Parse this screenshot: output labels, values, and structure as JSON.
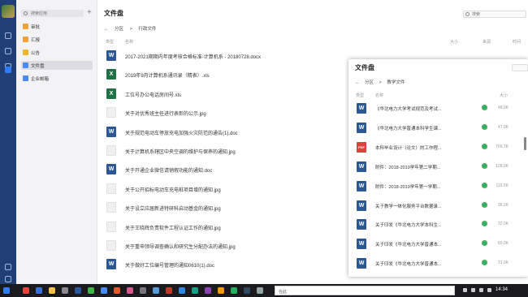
{
  "sidebar": {
    "search_placeholder": "搜索应用",
    "add_label": "+",
    "items": [
      {
        "label": "审批",
        "icon": "approval-icon",
        "color": "#f2a23a"
      },
      {
        "label": "汇报",
        "icon": "report-icon",
        "color": "#f2a23a"
      },
      {
        "label": "公告",
        "icon": "announcement-icon",
        "color": "#f0b429"
      },
      {
        "label": "文件盘",
        "icon": "drive-icon",
        "color": "#4a8bf5",
        "active": true
      },
      {
        "label": "企业邮箱",
        "icon": "mail-icon",
        "color": "#4a8bf5"
      }
    ]
  },
  "main": {
    "title": "文件盘",
    "search_placeholder": "搜索",
    "breadcrumb": [
      "←",
      "分区",
      ">",
      "行政文件"
    ],
    "columns": {
      "type": "类型",
      "name": "名称",
      "size": "大小",
      "source": "来源",
      "time": "时间"
    },
    "files": [
      {
        "type": "word",
        "name": "2017-2021期期内年度考核合格标准-计算机系 - 20180728.docx"
      },
      {
        "type": "excel",
        "name": "2019年9月计算机系通讯录（精表）.xls"
      },
      {
        "type": "excel",
        "name": "工位号办公电话房间号.xls"
      },
      {
        "type": "image",
        "name": "关于对优秀班主任进行表彰的公示.jpg"
      },
      {
        "type": "word",
        "name": "关于规范电动车停放充电加强火灾防范的通告(1).doc"
      },
      {
        "type": "image",
        "name": "关于计算机系辖区中央空调的维护与保养的通知.jpg"
      },
      {
        "type": "word",
        "name": "关于开通企业微信请销假功能的通知.doc"
      },
      {
        "type": "image",
        "name": "关于公开招标电动车充电桩项目增的通知.jpg"
      },
      {
        "type": "image",
        "name": "关于设立应届新进特研科启动基金的通知.jpg"
      },
      {
        "type": "image",
        "name": "关于王晓辉负责软件工程认证工作的通知.jpg"
      },
      {
        "type": "image",
        "name": "关于重申领导调查确认和研究生分配办法的通知.jpg"
      },
      {
        "type": "word",
        "name": "关于做好工位编号管理的通知0610(1).doc"
      }
    ]
  },
  "window2": {
    "title": "文件盘",
    "breadcrumb": [
      "←",
      "分区",
      ">",
      "教学文件"
    ],
    "columns": {
      "type": "类型",
      "name": "名称",
      "size": "大小"
    },
    "files": [
      {
        "type": "word",
        "name": "《华北电力大学考试规范及考试...",
        "size": "48.0K"
      },
      {
        "type": "word",
        "name": "《华北电力大学普通本科学生课...",
        "size": "47.0K"
      },
      {
        "type": "pdf",
        "name": "本科毕业设计（论文）的工作程...",
        "size": "766.7K"
      },
      {
        "type": "word",
        "name": "附件：2018-2019学年第二学期...",
        "size": "128.0K"
      },
      {
        "type": "word",
        "name": "附件：2018-2019学年第一学期...",
        "size": "119.5K"
      },
      {
        "type": "word",
        "name": "关于教学一体化服务平台数据录...",
        "size": "36.2K"
      },
      {
        "type": "word",
        "name": "关于印发《华北电力大学本科生...",
        "size": "32.0K"
      },
      {
        "type": "word",
        "name": "关于印发《华北电力大学普通本...",
        "size": "60.0K"
      },
      {
        "type": "word",
        "name": "关于印发《华北电力大学普通本...",
        "size": "31.0K"
      }
    ]
  },
  "taskbar": {
    "search_text": "在此",
    "time": "14:34"
  },
  "icons": {
    "word": "W",
    "excel": "X",
    "pdf": "PDF"
  }
}
